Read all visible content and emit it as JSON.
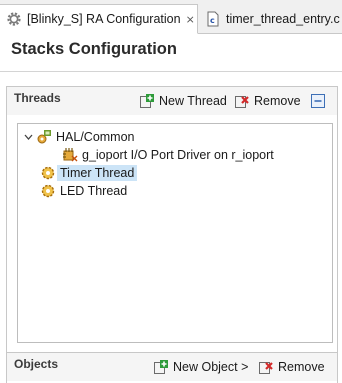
{
  "tabs": [
    {
      "label": "[Blinky_S] RA Configuration",
      "close": "⨯"
    },
    {
      "label": "timer_thread_entry.c"
    }
  ],
  "page_title": "Stacks Configuration",
  "threads": {
    "title": "Threads",
    "new_label": "New Thread",
    "remove_label": "Remove",
    "tree": [
      {
        "label": "HAL/Common",
        "expanded": true
      },
      {
        "label": "g_ioport I/O Port Driver on r_ioport"
      },
      {
        "label": "Timer Thread",
        "selected": true
      },
      {
        "label": "LED Thread"
      }
    ]
  },
  "objects": {
    "title": "Objects",
    "new_label": "New Object >",
    "remove_label": "Remove"
  },
  "colors": {
    "selection": "#cce4f7",
    "add_icon": "#2e9b3a",
    "remove_icon": "#d22a2a",
    "gear_icon": "#c88a18"
  }
}
